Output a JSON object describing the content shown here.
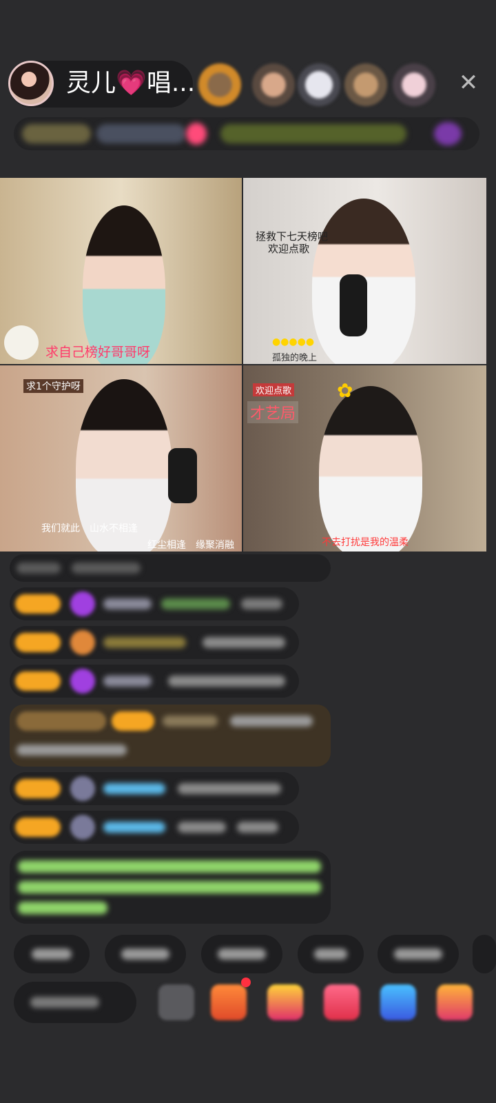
{
  "header": {
    "host_name": "灵儿💗唱...",
    "close_icon": "close-icon"
  },
  "video_grid": {
    "cells": [
      {
        "caption": "求自己榜好哥哥呀"
      },
      {
        "caption_top": "拯救下七天榜吧",
        "caption_top2": "欢迎点歌",
        "caption_bottom": "孤独的晚上"
      },
      {
        "caption_top": "求1个守护呀",
        "caption_bottom": "我们就此　山水不相逢",
        "caption_bottom2": "红尘相逢　缘聚消融"
      },
      {
        "caption_top": "欢迎点歌",
        "caption_tag": "才艺局",
        "caption_bottom": "不去打扰是我的温柔"
      }
    ]
  },
  "colors": {
    "background": "#2b2b2d",
    "level_badge": "#f5a623",
    "chat_name_blue": "#5bb8e8",
    "chat_system_green": "#8fd46a",
    "gift_pink": "#ff4b7a"
  }
}
